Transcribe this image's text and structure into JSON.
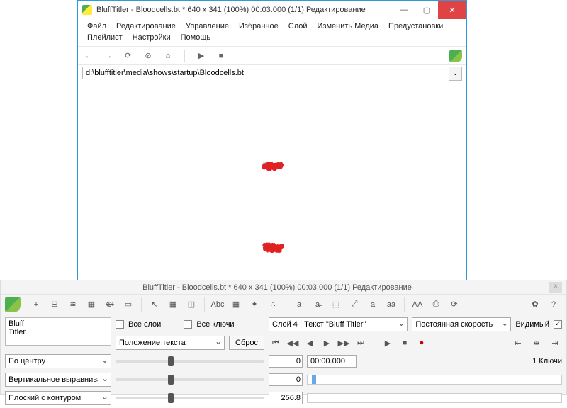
{
  "window": {
    "title": "BluffTitler - Bloodcells.bt * 640 x 341 (100%) 00:03.000 (1/1) Редактирование",
    "minimize": "—",
    "maximize": "▢",
    "close": "✕"
  },
  "menu": [
    "Файл",
    "Редактирование",
    "Управление",
    "Избранное",
    "Слой",
    "Изменить Медиа",
    "Предустановки",
    "Плейлист",
    "Настройки",
    "Помощь"
  ],
  "nav": {
    "back": "←",
    "forward": "→",
    "reload": "⟳",
    "stop": "⊘",
    "home": "⌂",
    "play": "▶",
    "stopmedia": "■"
  },
  "address": "d:\\blufftitler\\media\\shows\\startup\\Bloodcells.bt",
  "address_btn": "⌄",
  "preview_text_line1": "Bluff",
  "preview_text_line2": "Titler",
  "panel": {
    "title": "BluffTitler - Bloodcells.bt * 640 x 341 (100%) 00:03.000 (1/1) Редактирование",
    "close": "×",
    "layer_text": "Bluff\nTitler",
    "all_layers": "Все слои",
    "all_keys": "Все ключи",
    "layer_select": "Слой 4  : Текст \"Bluff Titler\"",
    "speed_select": "Постоянная скорость",
    "visible": "Видимый",
    "prop_select": "Положение текста",
    "reset": "Сброс",
    "align_select": "По центру",
    "valign_select": "Вертикальное выравнивание",
    "outline_select": "Плоский с контуром",
    "val1": "0",
    "val2": "0",
    "val3": "256.8",
    "time": "00:00.000",
    "keys_label": "1 Ключи"
  },
  "toolbar_icons": [
    "+",
    "⊟",
    "≋",
    "▦",
    "⟴",
    "▭",
    "↖",
    "▦",
    "◫",
    "Abc",
    "▦",
    "✦",
    "∴",
    "a",
    "a̶",
    "⬚",
    "⤢",
    "a",
    "aa",
    "AA",
    "⎙",
    "⟳",
    "✿",
    "?"
  ]
}
